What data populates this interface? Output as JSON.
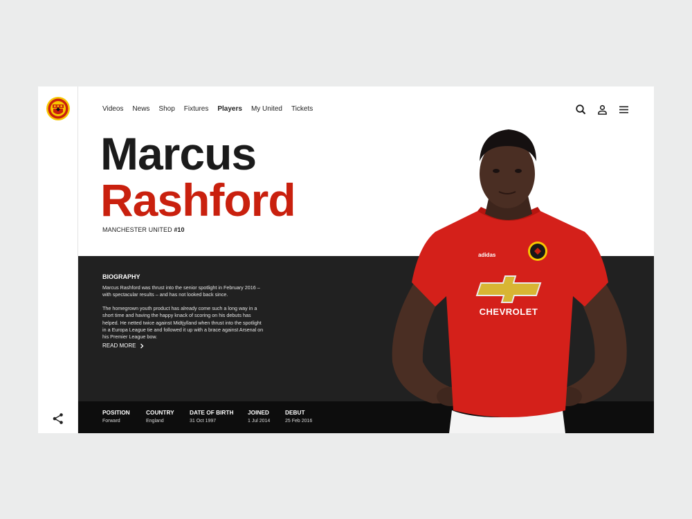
{
  "nav": {
    "items": [
      {
        "label": "Videos",
        "active": false
      },
      {
        "label": "News",
        "active": false
      },
      {
        "label": "Shop",
        "active": false
      },
      {
        "label": "Fixtures",
        "active": false
      },
      {
        "label": "Players",
        "active": true
      },
      {
        "label": "My United",
        "active": false
      },
      {
        "label": "Tickets",
        "active": false
      }
    ],
    "icons": [
      "search-icon",
      "user-icon",
      "menu-icon"
    ]
  },
  "player": {
    "first_name": "Marcus",
    "last_name": "Rashford",
    "club": "MANCHESTER UNITED",
    "number": "#10",
    "sponsor": "CHEVROLET"
  },
  "biography": {
    "title": "BIOGRAPHY",
    "paragraph1": "Marcus Rashford was thrust into the senior spotlight in February 2016 – with spectacular results – and has not looked back since.",
    "paragraph2": "The homegrown youth product has already come such a long way in a short time and having the happy knack of scoring on his debuts has helped. He netted twice against Midtjylland when thrust into the spotlight in a Europa League tie and followed it up with a brace against Arsenal on his Premier League bow.",
    "read_more": "READ MORE"
  },
  "stats": [
    {
      "label": "POSITION",
      "value": "Forward"
    },
    {
      "label": "COUNTRY",
      "value": "England"
    },
    {
      "label": "DATE OF BIRTH",
      "value": "31 Oct 1997"
    },
    {
      "label": "JOINED",
      "value": "1 Jul 2014"
    },
    {
      "label": "DEBUT",
      "value": "25 Feb 2016"
    }
  ],
  "colors": {
    "accent_red": "#c9200e",
    "dark_panel": "#212121",
    "stats_bar": "#0d0d0d",
    "background": "#ebecec"
  }
}
